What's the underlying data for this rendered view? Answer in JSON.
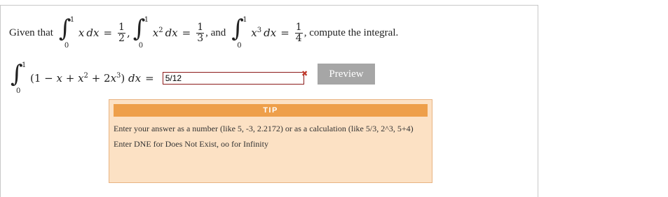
{
  "question": {
    "given_label": "Given that",
    "integral1": {
      "upper": "1",
      "lower": "0",
      "integrand": "x dx",
      "result_num": "1",
      "result_den": "2"
    },
    "integral2": {
      "upper": "1",
      "lower": "0",
      "integrand": "x² dx",
      "result_num": "1",
      "result_den": "3"
    },
    "and_label": ", and",
    "integral3": {
      "upper": "1",
      "lower": "0",
      "integrand": "x³ dx",
      "result_num": "1",
      "result_den": "4"
    },
    "compute_label": ", compute the integral.",
    "target_integral": {
      "upper": "1",
      "lower": "0",
      "integrand": "(1 − x + x² + 2x³) dx"
    }
  },
  "answer": {
    "value": "5/12",
    "status": "incorrect"
  },
  "preview_button": {
    "label": "Preview"
  },
  "tip": {
    "title": "TIP",
    "line1": "Enter your answer as a number (like 5, -3, 2.2172) or as a calculation (like 5/3, 2^3, 5+4)",
    "line2": "Enter DNE for Does Not Exist, oo for Infinity"
  },
  "colors": {
    "tip_header": "#ee9f4a",
    "tip_background": "#fce1c4",
    "answer_border": "#8b1a1a",
    "preview_button": "#a6a6a6",
    "wrong_mark": "#c0392b"
  }
}
